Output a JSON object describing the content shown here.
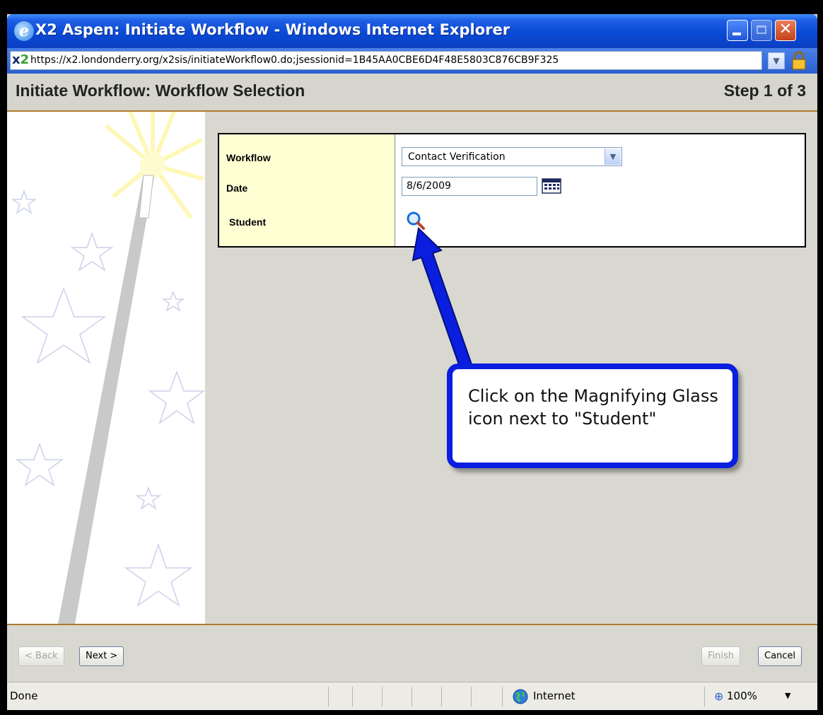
{
  "window": {
    "title": "X2 Aspen: Initiate Workflow - Windows Internet Explorer",
    "close_glyph": "✕"
  },
  "address_bar": {
    "logo_x": "x",
    "logo_2": "2",
    "url": "https://x2.londonderry.org/x2sis/initiateWorkflow0.do;jsessionid=1B45AA0CBE6D4F48E5803C876CB9F325"
  },
  "header": {
    "title": "Initiate Workflow: Workflow Selection",
    "step": "Step 1 of 3"
  },
  "form": {
    "workflow_label": "Workflow",
    "workflow_value": "Contact Verification",
    "date_label": "Date",
    "date_value": "8/6/2009",
    "student_label": "Student"
  },
  "callout": {
    "text": "Click on the Magnifying Glass icon next to \"Student\"",
    "color": "#0a1ee0"
  },
  "footer": {
    "back_label": "< Back",
    "next_label": "Next >",
    "finish_label": "Finish",
    "cancel_label": "Cancel"
  },
  "statusbar": {
    "status": "Done",
    "zone": "Internet",
    "zoom": "100%"
  }
}
